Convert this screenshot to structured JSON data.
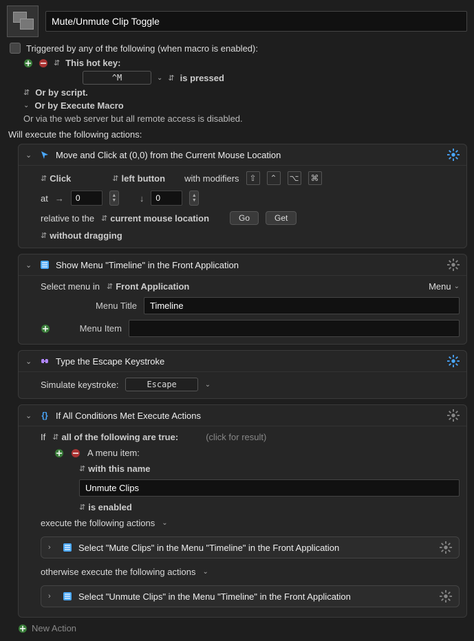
{
  "header": {
    "title": "Mute/Unmute Clip Toggle"
  },
  "trigger": {
    "checkbox_label": "Triggered by any of the following (when macro is enabled):",
    "hotkey_label": "This hot key:",
    "hotkey_value": "^M",
    "hotkey_state": "is pressed",
    "or_script": "Or by script.",
    "or_execute_macro": "Or by Execute Macro",
    "or_webserver": "Or via the web server but all remote access is disabled."
  },
  "actions_header": "Will execute the following actions:",
  "action1": {
    "title": "Move and Click at (0,0) from the Current Mouse Location",
    "click": "Click",
    "button": "left button",
    "modifiers_label": "with modifiers",
    "at": "at",
    "x": "0",
    "y": "0",
    "relative_label": "relative to the",
    "relative_value": "current mouse location",
    "go": "Go",
    "get": "Get",
    "drag": "without dragging"
  },
  "action2": {
    "title": "Show Menu \"Timeline\" in the Front Application",
    "select_label": "Select menu in",
    "app": "Front Application",
    "menu_btn": "Menu",
    "menu_title_label": "Menu Title",
    "menu_title_value": "Timeline",
    "menu_item_label": "Menu Item",
    "menu_item_value": ""
  },
  "action3": {
    "title": "Type the Escape Keystroke",
    "simulate_label": "Simulate keystroke:",
    "key": "Escape"
  },
  "action4": {
    "title": "If All Conditions Met Execute Actions",
    "if_label": "If",
    "all_true": "all of the following are true:",
    "hint": "(click for result)",
    "cond_label": "A menu item:",
    "with_name": "with this name",
    "name_value": "Unmute Clips",
    "enabled": "is enabled",
    "execute_label": "execute the following actions",
    "then_action": "Select \"Mute Clips\" in the Menu \"Timeline\" in the Front Application",
    "otherwise_label": "otherwise execute the following actions",
    "else_action": "Select \"Unmute Clips\" in the Menu \"Timeline\" in the Front Application"
  },
  "footer": {
    "new_action": "New Action"
  }
}
